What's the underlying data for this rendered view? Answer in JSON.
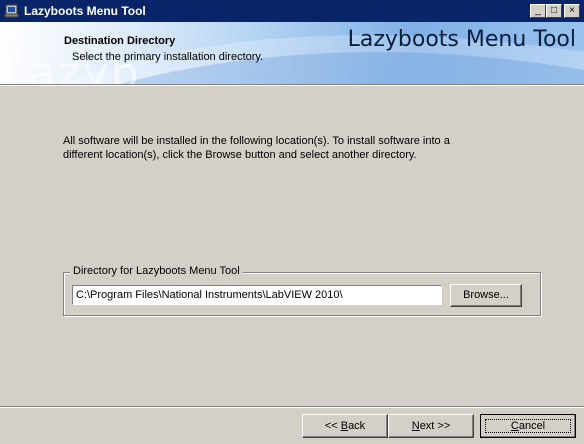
{
  "window": {
    "title": "Lazyboots Menu Tool"
  },
  "titlebar_buttons": {
    "minimize": "_",
    "maximize": "□",
    "close": "×"
  },
  "banner": {
    "title": "Destination Directory",
    "subtitle": "Select the primary installation directory.",
    "brand": "Lazyboots Menu Tool",
    "watermark": "Lazyb"
  },
  "main": {
    "description": "All software will be installed in the following location(s). To install software into a different location(s), click the Browse button and select another directory."
  },
  "directory_group": {
    "legend": "Directory for Lazyboots Menu Tool",
    "path_value": "C:\\Program Files\\National Instruments\\LabVIEW 2010\\",
    "browse_label": "Browse..."
  },
  "footer": {
    "back_prefix": "<< ",
    "back_accel": "B",
    "back_rest": "ack",
    "next_accel": "N",
    "next_rest": "ext >>",
    "cancel_accel": "C",
    "cancel_rest": "ancel"
  },
  "colors": {
    "titlebar": "#0a246a",
    "dialog_bg": "#d4d0c8"
  },
  "icons": {
    "app": "installer-icon",
    "minimize": "minimize-icon",
    "maximize": "maximize-icon",
    "close": "close-icon"
  }
}
